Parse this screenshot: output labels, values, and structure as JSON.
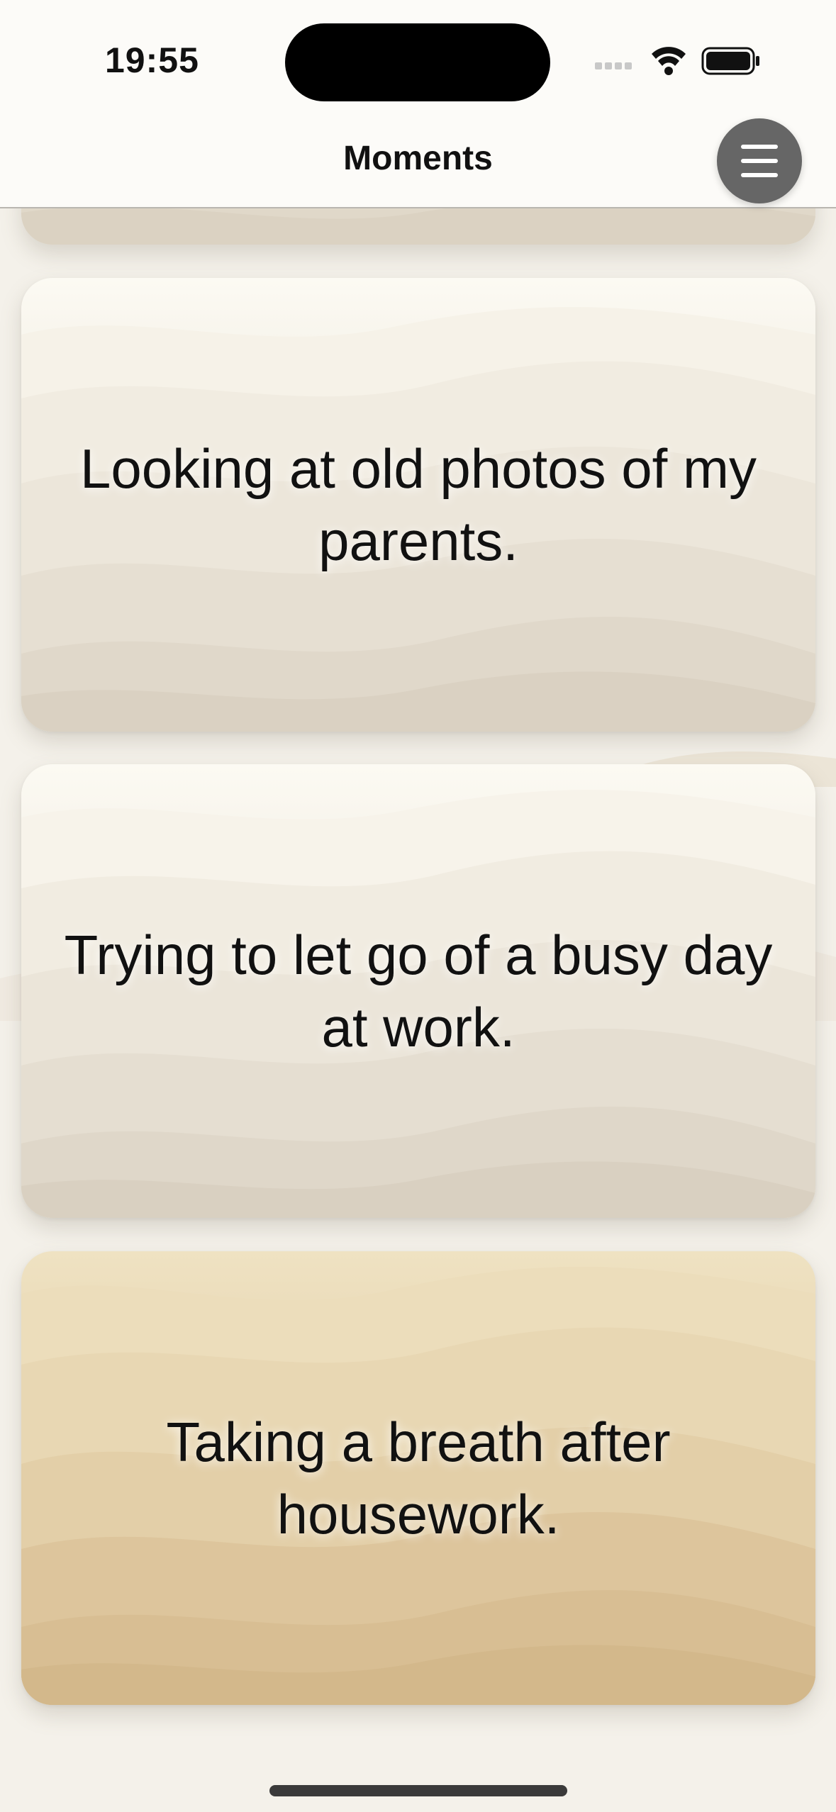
{
  "status_bar": {
    "time": "19:55",
    "icons": [
      "cellular-signal-icon",
      "wifi-icon",
      "battery-icon"
    ]
  },
  "nav": {
    "title": "Moments",
    "menu_icon": "hamburger-menu-icon"
  },
  "cards": [
    {
      "text": "Looking at old photos of my parents.",
      "theme": "light-sand"
    },
    {
      "text": "Trying to let go of a busy day at work.",
      "theme": "light-sand"
    },
    {
      "text": "Taking a breath after housework.",
      "theme": "golden-sand"
    }
  ],
  "colors": {
    "background": "#f4f1ea",
    "light_sand_top": "#fbf9f1",
    "light_sand_bottom": "#ddd5c6",
    "golden_sand_top": "#efe2c2",
    "golden_sand_bottom": "#d5bc91",
    "menu_button": "#666666"
  }
}
